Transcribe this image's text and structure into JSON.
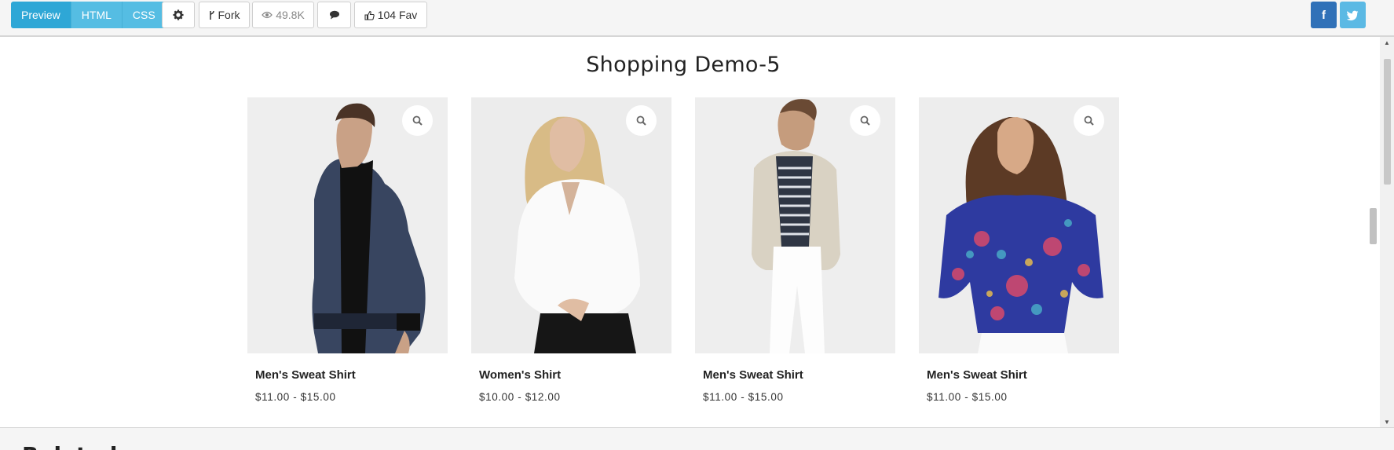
{
  "toolbar": {
    "tabs": [
      "Preview",
      "HTML",
      "CSS"
    ],
    "fork_label": "Fork",
    "views_label": "49.8K",
    "fav_label": "104 Fav",
    "facebook_label": "f"
  },
  "page": {
    "title": "Shopping Demo-5",
    "products": [
      {
        "name": "Men's Sweat Shirt",
        "price": "$11.00 - $15.00"
      },
      {
        "name": "Women's Shirt",
        "price": "$10.00 - $12.00"
      },
      {
        "name": "Men's Sweat Shirt",
        "price": "$11.00 - $15.00"
      },
      {
        "name": "Men's Sweat Shirt",
        "price": "$11.00 - $15.00"
      }
    ],
    "related_heading": "Related"
  },
  "colors": {
    "accent": "#2ea7d6",
    "facebook": "#3071b8",
    "twitter": "#5bb9e4"
  }
}
